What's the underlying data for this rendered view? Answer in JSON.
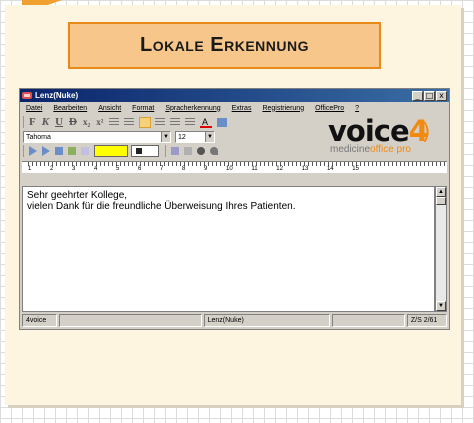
{
  "slide": {
    "title": "Lokale Erkennung"
  },
  "window": {
    "title": "Lenz(Nuke)",
    "controls": {
      "minimize": "_",
      "maximize": "□",
      "close": "x"
    }
  },
  "menu": [
    "Datei",
    "Bearbeiten",
    "Ansicht",
    "Format",
    "Spracherkennung",
    "Extras",
    "Registrierung",
    "OfficePro",
    "?"
  ],
  "toolbar": {
    "format_glyphs": [
      "F",
      "K",
      "U",
      "D",
      "x₂",
      "x²"
    ],
    "font": "Tahoma",
    "font_size": "12",
    "dropdown_arrow": "▼"
  },
  "logo": {
    "brand_main": "voice",
    "brand_num": "4",
    "brand_paren": ")",
    "sub_medicine": "medicine",
    "sub_office": "office pro"
  },
  "ruler": {
    "numbers": "1 2 3 4 5 6 7 8 9 10 11 12 13 14 15"
  },
  "document": {
    "line1": "Sehr geehrter Kollege,",
    "line2": "vielen Dank für die freundliche Überweisung Ihres Patienten."
  },
  "scroll": {
    "up": "▲",
    "down": "▼"
  },
  "status": {
    "left": "4voice",
    "middle": "Lenz(Nuke)",
    "right": "Z/S 2/61"
  },
  "colors": {
    "accent": "#f08a10",
    "title_bg": "#f7c68a",
    "card_bg": "#fdf5e0",
    "titlebar": "#0a246a"
  }
}
